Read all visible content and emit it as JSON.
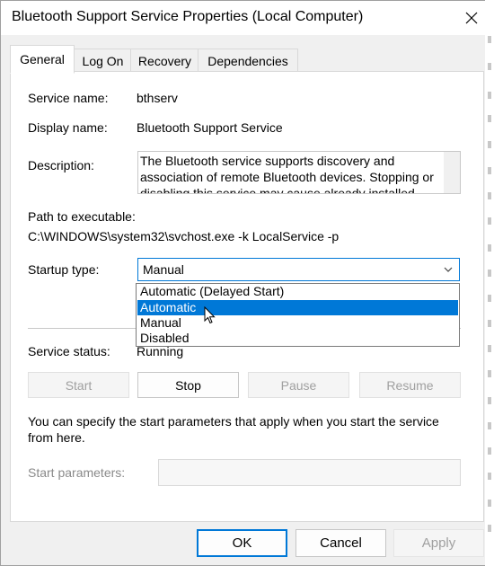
{
  "window": {
    "title": "Bluetooth Support Service Properties (Local Computer)"
  },
  "tabs": [
    {
      "label": "General"
    },
    {
      "label": "Log On"
    },
    {
      "label": "Recovery"
    },
    {
      "label": "Dependencies"
    }
  ],
  "general": {
    "service_name_label": "Service name:",
    "service_name_value": "bthserv",
    "display_name_label": "Display name:",
    "display_name_value": "Bluetooth Support Service",
    "description_label": "Description:",
    "description_value": "The Bluetooth service supports discovery and association of remote Bluetooth devices.  Stopping or disabling this service may cause already installed",
    "path_label": "Path to executable:",
    "path_value": "C:\\WINDOWS\\system32\\svchost.exe -k LocalService -p",
    "startup_type_label": "Startup type:",
    "startup_type_value": "Manual",
    "startup_options": [
      {
        "label": "Automatic (Delayed Start)"
      },
      {
        "label": "Automatic"
      },
      {
        "label": "Manual"
      },
      {
        "label": "Disabled"
      }
    ],
    "service_status_label": "Service status:",
    "service_status_value": "Running",
    "buttons": {
      "start": "Start",
      "stop": "Stop",
      "pause": "Pause",
      "resume": "Resume"
    },
    "info_text": "You can specify the start parameters that apply when you start the service from here.",
    "start_params_label": "Start parameters:"
  },
  "footer": {
    "ok": "OK",
    "cancel": "Cancel",
    "apply": "Apply"
  },
  "colors": {
    "accent": "#0078d7",
    "dialog_bg": "#f0f0f0",
    "panel_bg": "#ffffff",
    "disabled_text": "#a0a0a0"
  },
  "icons": {
    "close": "close-icon",
    "dropdown": "chevron-down-icon",
    "cursor": "mouse-pointer-icon"
  }
}
